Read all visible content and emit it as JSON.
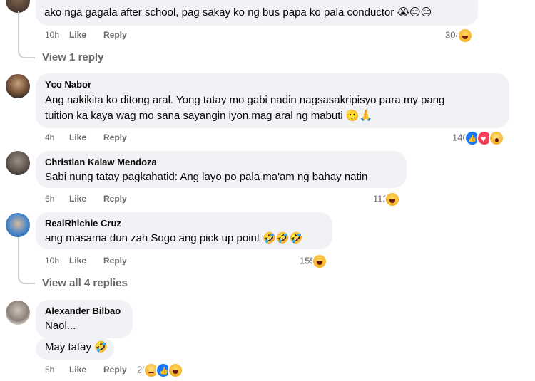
{
  "comments": [
    {
      "text": "ako nga gagala after school, pag sakay ko ng bus papa ko pala conductor 😭😑😑",
      "time": "10h",
      "like": "Like",
      "reply": "Reply",
      "reactions": "304"
    },
    {
      "name": "Yco Nabor",
      "text_line1": "Ang nakikita ko ditong aral. Yong tatay mo gabi nadin nagsasakripisyo para my pang",
      "text_line2": "tuition ka kaya wag mo sana sayangin iyon.mag aral ng mabuti 🫡🙏",
      "time": "4h",
      "like": "Like",
      "reply": "Reply",
      "reactions": "146"
    },
    {
      "name": "Christian Kalaw Mendoza",
      "text": "Sabi nung tatay pagkahatid: Ang layo po pala ma'am ng bahay natin",
      "time": "6h",
      "like": "Like",
      "reply": "Reply",
      "reactions": "112"
    },
    {
      "name": "RealRhichie Cruz",
      "text": "ang masama dun zah Sogo ang pick up point 🤣🤣🤣",
      "time": "10h",
      "like": "Like",
      "reply": "Reply",
      "reactions": "155"
    },
    {
      "name": "Alexander Bilbao",
      "text_line1": "Naol...",
      "text_line2": "May tatay 🤣",
      "time": "5h",
      "like": "Like",
      "reply": "Reply",
      "reactions": "20"
    }
  ],
  "view_replies": {
    "one": "View 1 reply",
    "four": "View all 4 replies"
  },
  "colors": {
    "bubble": "#f0f2f5",
    "meta_text": "#65676b",
    "like_blue": "#1877f2",
    "love_red": "#f33e58",
    "emoji_yellow": "#f7b125"
  },
  "icons": [
    "haha-reaction-icon",
    "like-reaction-icon",
    "love-reaction-icon",
    "wow-reaction-icon",
    "sad-reaction-icon"
  ]
}
